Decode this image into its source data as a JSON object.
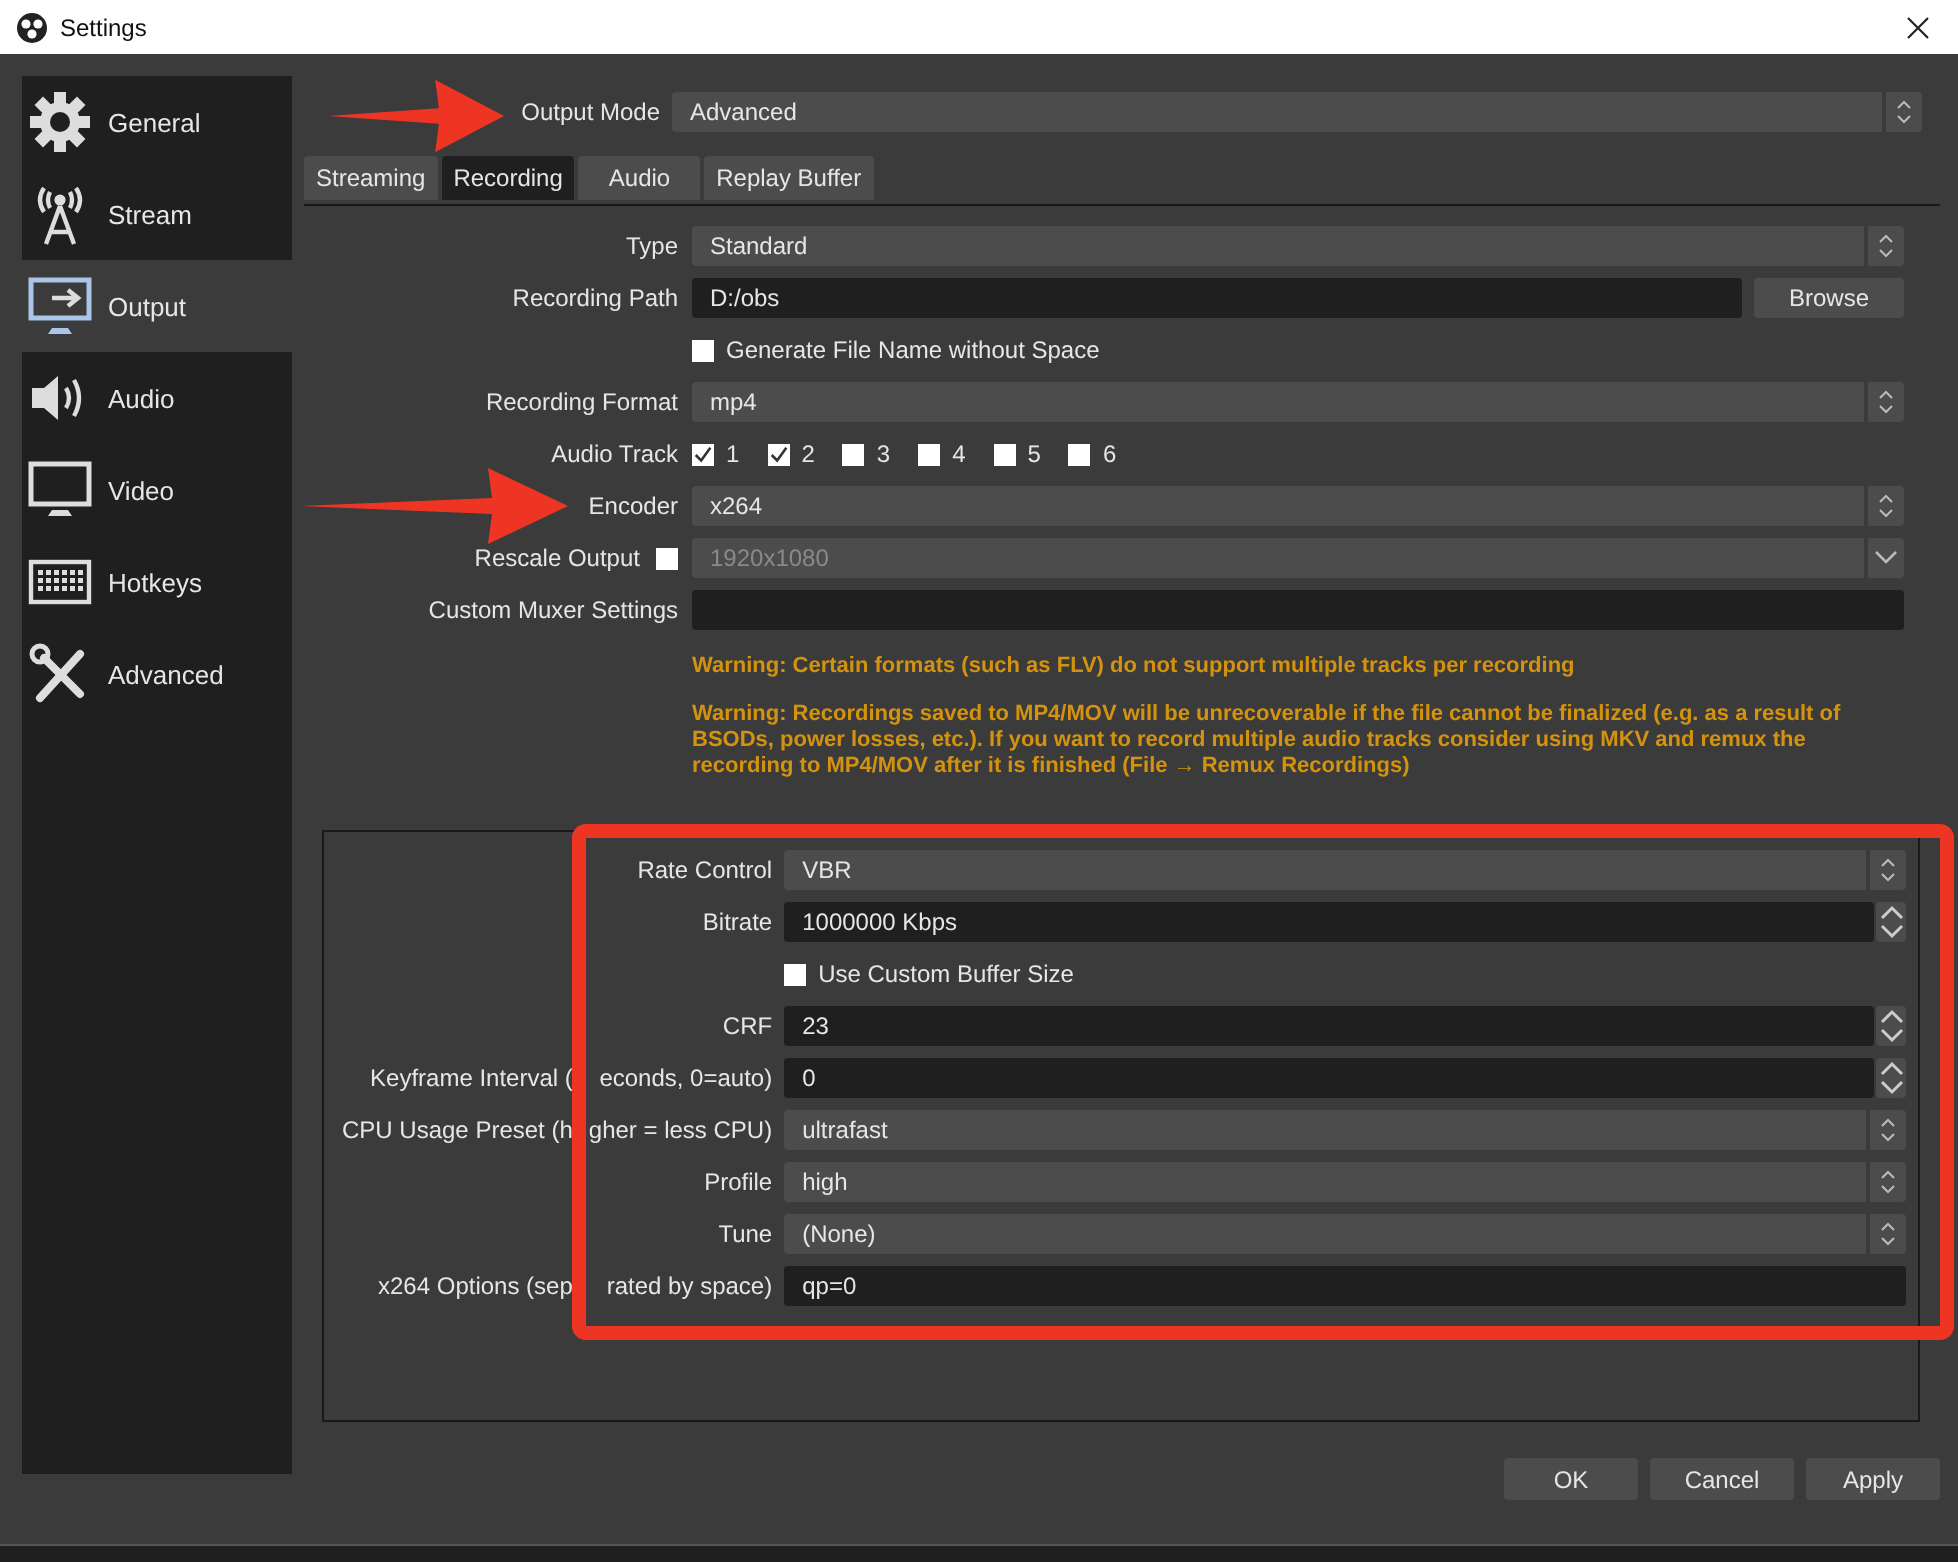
{
  "window": {
    "title": "Settings"
  },
  "sidebar": {
    "items": [
      {
        "label": "General",
        "kind": "gear",
        "selected": false
      },
      {
        "label": "Stream",
        "kind": "antenna",
        "selected": false
      },
      {
        "label": "Output",
        "kind": "output",
        "selected": true
      },
      {
        "label": "Audio",
        "kind": "speaker",
        "selected": false
      },
      {
        "label": "Video",
        "kind": "monitor",
        "selected": false
      },
      {
        "label": "Hotkeys",
        "kind": "keyboard",
        "selected": false
      },
      {
        "label": "Advanced",
        "kind": "tools",
        "selected": false
      }
    ]
  },
  "output_mode": {
    "label": "Output Mode",
    "value": "Advanced"
  },
  "tabs": [
    {
      "label": "Streaming",
      "selected": false
    },
    {
      "label": "Recording",
      "selected": true
    },
    {
      "label": "Audio",
      "selected": false
    },
    {
      "label": "Replay Buffer",
      "selected": false
    }
  ],
  "recording": {
    "rows": [
      {
        "kind": "combo",
        "label": "Type",
        "value": "Standard"
      },
      {
        "kind": "path",
        "label": "Recording Path",
        "value": "D:/obs",
        "button": "Browse"
      },
      {
        "kind": "checkbox",
        "label": "Generate File Name without Space",
        "checked": false
      },
      {
        "kind": "combo",
        "label": "Recording Format",
        "value": "mp4"
      },
      {
        "kind": "tracks",
        "label": "Audio Track",
        "tracks": [
          {
            "label": "1",
            "checked": true
          },
          {
            "label": "2",
            "checked": true
          },
          {
            "label": "3",
            "checked": false
          },
          {
            "label": "4",
            "checked": false
          },
          {
            "label": "5",
            "checked": false
          },
          {
            "label": "6",
            "checked": false
          }
        ]
      },
      {
        "kind": "combo",
        "label": "Encoder",
        "value": "x264"
      },
      {
        "kind": "rescale",
        "label": "Rescale Output",
        "checked": false,
        "value": "1920x1080",
        "disabled": true
      },
      {
        "kind": "text",
        "label": "Custom Muxer Settings"
      }
    ],
    "warnings": [
      "Warning: Certain formats (such as FLV) do not support multiple tracks per recording",
      "Warning: Recordings saved to MP4/MOV will be unrecoverable if the file cannot be finalized (e.g. as a result of BSODs, power losses, etc.). If you want to record multiple audio tracks consider using MKV and remux the recording to MP4/MOV after it is finished (File → Remux Recordings)"
    ]
  },
  "encoder_settings": {
    "rows": [
      {
        "kind": "combo",
        "label": "Rate Control",
        "value": "VBR"
      },
      {
        "kind": "spin",
        "label": "Bitrate",
        "value": "1000000 Kbps"
      },
      {
        "kind": "checkbox",
        "label": "Use Custom Buffer Size",
        "checked": false
      },
      {
        "kind": "spin",
        "label": "CRF",
        "value": "23"
      },
      {
        "kind": "spin",
        "label_parts": [
          "Keyframe Interval (",
          "econds, 0=auto)"
        ],
        "value": "0"
      },
      {
        "kind": "combo",
        "label_parts": [
          "CPU Usage Preset (h",
          "gher = less CPU)"
        ],
        "value": "ultrafast"
      },
      {
        "kind": "combo",
        "label": "Profile",
        "value": "high"
      },
      {
        "kind": "combo",
        "label": "Tune",
        "value": "(None)"
      },
      {
        "kind": "text",
        "label_parts": [
          "x264 Options (sep",
          "rated by space)"
        ],
        "value": "qp=0"
      }
    ]
  },
  "buttons": [
    {
      "label": "OK"
    },
    {
      "label": "Cancel"
    },
    {
      "label": "Apply"
    }
  ]
}
